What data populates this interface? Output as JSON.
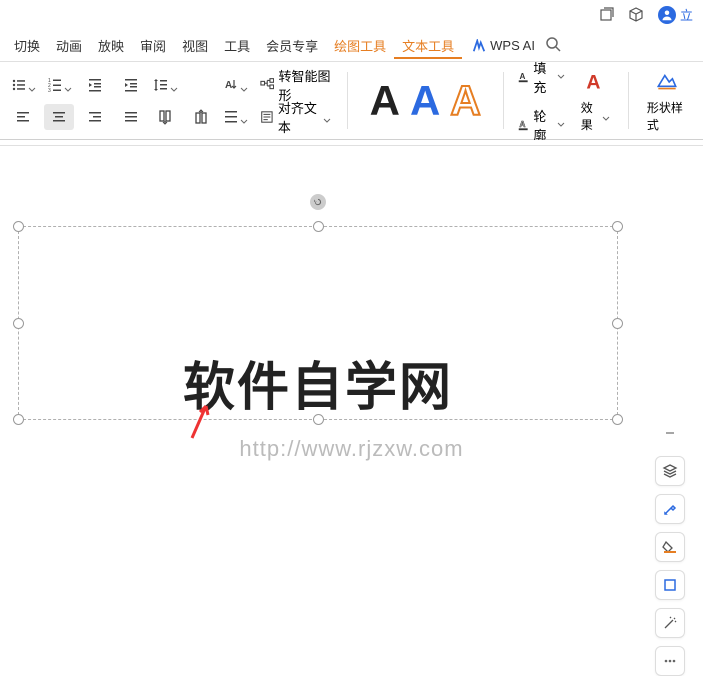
{
  "header": {
    "user_label": "立"
  },
  "menu": {
    "items": [
      "切换",
      "动画",
      "放映",
      "审阅",
      "视图",
      "工具",
      "会员专享"
    ],
    "drawing_tools": "绘图工具",
    "text_tools": "文本工具",
    "ai_label": "WPS AI"
  },
  "toolbar": {
    "smart_graphic": "转智能图形",
    "align_text": "对齐文本",
    "fill_label": "填充",
    "outline_label": "轮廓",
    "effect_label": "效果",
    "shape_style": "形状样式"
  },
  "canvas": {
    "main_text": "软件自学网",
    "sub_url": "http://www.rjzxw.com"
  }
}
